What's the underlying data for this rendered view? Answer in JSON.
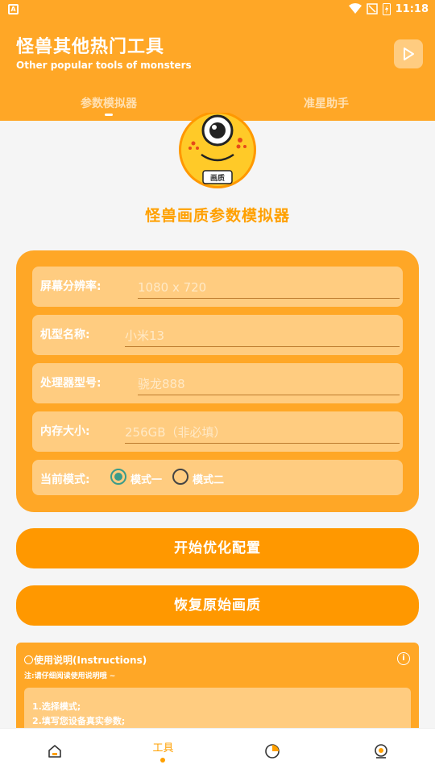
{
  "status_bar": {
    "time": "11:18",
    "icons": [
      "wifi-icon",
      "signal-off-icon",
      "battery-charging-icon"
    ]
  },
  "header": {
    "title": "怪兽其他热门工具",
    "subtitle": "Other popular tools of monsters",
    "play_icon": "play-icon"
  },
  "tabs": [
    {
      "label": "参数模拟器",
      "active": true
    },
    {
      "label": "准星助手",
      "active": false
    }
  ],
  "mascot": {
    "badge": "画质"
  },
  "tool_title": "怪兽画质参数模拟器",
  "form": {
    "resolution": {
      "label": "屏幕分辨率:",
      "placeholder": "1080 x 720"
    },
    "model": {
      "label": "机型名称:",
      "placeholder": "小米13"
    },
    "cpu": {
      "label": "处理器型号:",
      "placeholder": "骁龙888"
    },
    "memory": {
      "label": "内存大小:",
      "placeholder": "256GB（非必填）"
    },
    "mode": {
      "label": "当前模式:",
      "options": [
        "模式一",
        "模式二"
      ],
      "selected": "模式一"
    }
  },
  "buttons": {
    "start": "开始优化配置",
    "restore": "恢复原始画质"
  },
  "instructions": {
    "title": "使用说明(Instructions)",
    "note": "注:请仔细阅读使用说明哦 ~",
    "steps": [
      "1.选择模式;",
      "2.填写您设备真实参数;"
    ]
  },
  "bottom_nav": [
    {
      "icon": "home-icon",
      "label": ""
    },
    {
      "icon": "tools-icon",
      "label": "工具",
      "active": true
    },
    {
      "icon": "chart-icon",
      "label": ""
    },
    {
      "icon": "profile-icon",
      "label": ""
    }
  ],
  "colors": {
    "primary": "#ffa726",
    "light": "#ffcc80",
    "button": "#ff9800",
    "accent_text": "#ffa000",
    "radio_selected": "#3a9b89"
  }
}
